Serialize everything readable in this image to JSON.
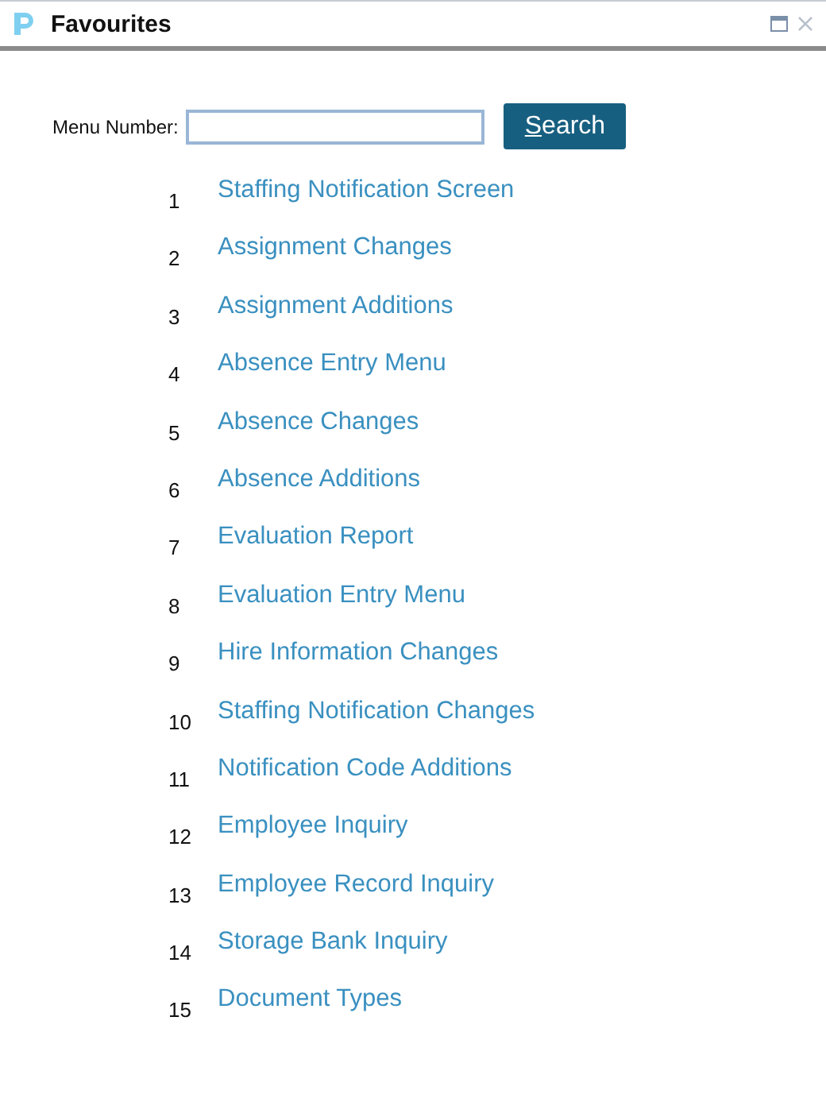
{
  "window": {
    "title": "Favourites"
  },
  "search": {
    "label": "Menu Number:",
    "button": "Search",
    "access_key_underlined": true
  },
  "items": [
    {
      "number": "1",
      "label": "Staffing Notification Screen"
    },
    {
      "number": "2",
      "label": "Assignment Changes"
    },
    {
      "number": "3",
      "label": "Assignment Additions"
    },
    {
      "number": "4",
      "label": "Absence Entry Menu"
    },
    {
      "number": "5",
      "label": "Absence Changes"
    },
    {
      "number": "6",
      "label": "Absence Additions"
    },
    {
      "number": "7",
      "label": "Evaluation Report"
    },
    {
      "number": "8",
      "label": "Evaluation Entry Menu"
    },
    {
      "number": "9",
      "label": "Hire Information Changes"
    },
    {
      "number": "10",
      "label": "Staffing Notification Changes"
    },
    {
      "number": "11",
      "label": "Notification Code Additions"
    },
    {
      "number": "12",
      "label": "Employee Inquiry"
    },
    {
      "number": "13",
      "label": "Employee Record Inquiry"
    },
    {
      "number": "14",
      "label": "Storage Bank Inquiry"
    },
    {
      "number": "15",
      "label": "Document Types"
    }
  ]
}
